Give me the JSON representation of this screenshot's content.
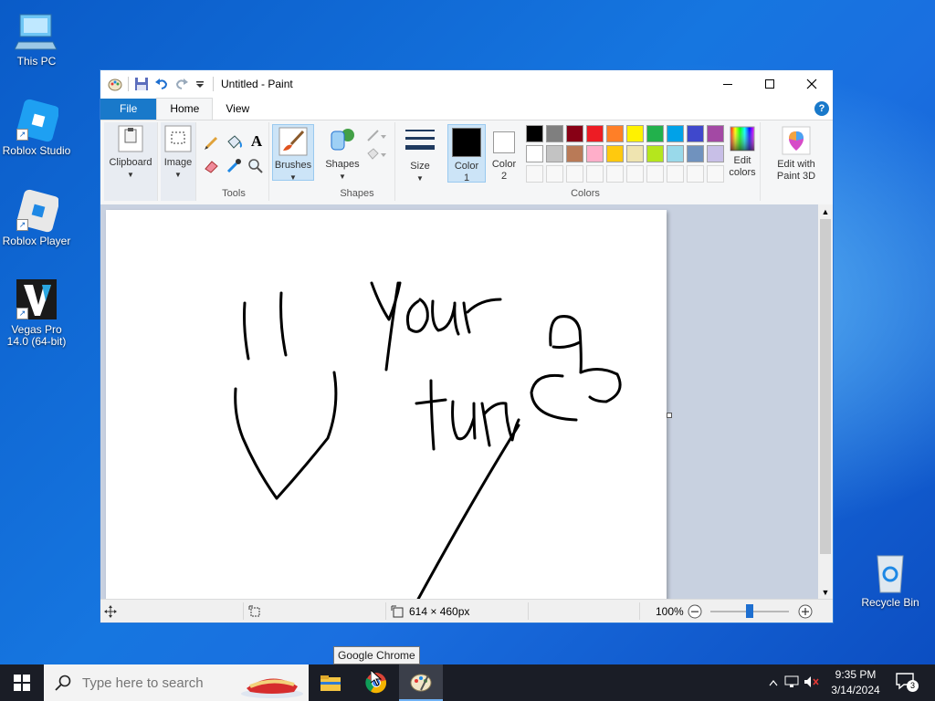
{
  "desktop": {
    "icons": [
      {
        "label": "This PC"
      },
      {
        "label": "Roblox Studio"
      },
      {
        "label": "Roblox Player"
      },
      {
        "label": "Vegas Pro 14.0 (64-bit)"
      },
      {
        "label": "Recycle Bin"
      }
    ]
  },
  "window": {
    "title": "Untitled - Paint",
    "tabs": [
      {
        "label": "File"
      },
      {
        "label": "Home"
      },
      {
        "label": "View"
      }
    ],
    "help": "?"
  },
  "ribbon": {
    "clipboard": "Clipboard",
    "image": "Image",
    "tools_group": "Tools",
    "brushes": "Brushes",
    "shapes_btn": "Shapes",
    "shapes_group": "Shapes",
    "size": "Size",
    "color1": "Color",
    "color1_num": "1",
    "color2": "Color",
    "color2_num": "2",
    "colors_group": "Colors",
    "edit_colors_1": "Edit",
    "edit_colors_2": "colors",
    "paint3d_1": "Edit with",
    "paint3d_2": "Paint 3D",
    "palette_row1": [
      "#000000",
      "#7f7f7f",
      "#880015",
      "#ed1c24",
      "#ff7f27",
      "#fff200",
      "#22b14c",
      "#00a2e8",
      "#3f48cc",
      "#a349a4"
    ],
    "palette_row2": [
      "#ffffff",
      "#c3c3c3",
      "#b97a57",
      "#ffaec9",
      "#ffc90e",
      "#efe4b0",
      "#b5e61d",
      "#99d9ea",
      "#7092be",
      "#c8bfe7"
    ]
  },
  "status": {
    "canvas_size": "614 × 460px",
    "zoom": "100%",
    "zoom_fraction": 0.5
  },
  "tooltip": "Google Chrome",
  "taskbar": {
    "search_placeholder": "Type here to search",
    "time": "9:35 PM",
    "date": "3/14/2024",
    "notifications": "3"
  }
}
